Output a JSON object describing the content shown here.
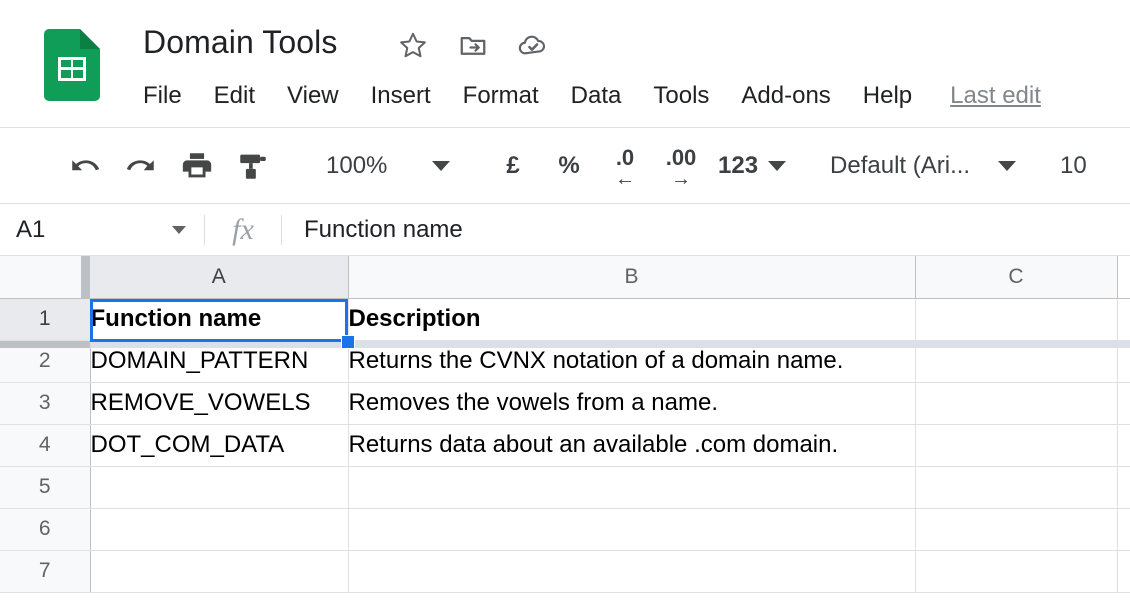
{
  "app": {
    "logo_icon": "google-sheets-logo",
    "doc_title": "Domain Tools"
  },
  "title_icons": [
    {
      "name": "star-icon",
      "label": "Star"
    },
    {
      "name": "move-to-folder-icon",
      "label": "Move to folder"
    },
    {
      "name": "cloud-saved-icon",
      "label": "Saved to Drive"
    }
  ],
  "menubar": {
    "items": [
      {
        "label": "File"
      },
      {
        "label": "Edit"
      },
      {
        "label": "View"
      },
      {
        "label": "Insert"
      },
      {
        "label": "Format"
      },
      {
        "label": "Data"
      },
      {
        "label": "Tools"
      },
      {
        "label": "Add-ons"
      },
      {
        "label": "Help"
      }
    ],
    "last_edit": "Last edit"
  },
  "toolbar": {
    "undo_icon": "undo-icon",
    "redo_icon": "redo-icon",
    "print_icon": "print-icon",
    "paint_format_icon": "paint-format-icon",
    "zoom_value": "100%",
    "currency_label": "£",
    "percent_label": "%",
    "decrease_decimal_digits": ".0",
    "decrease_decimal_arrow": "←",
    "increase_decimal_digits": ".00",
    "increase_decimal_arrow": "→",
    "number_format_label": "123",
    "font_value": "Default (Ari...",
    "font_size_value": "10"
  },
  "formula_bar": {
    "name_box_value": "A1",
    "fx_icon": "fx-icon",
    "formula_value": "Function name"
  },
  "grid": {
    "column_headers": [
      "A",
      "B",
      "C"
    ],
    "selected_column": "A",
    "selected_row": "1",
    "selected_cell": "A1",
    "frozen_rows": 1,
    "rows": [
      {
        "num": "1",
        "a": "Function name",
        "b": "Description",
        "c": ""
      },
      {
        "num": "2",
        "a": "DOMAIN_PATTERN",
        "b": "Returns the CVNX notation of a domain name.",
        "c": ""
      },
      {
        "num": "3",
        "a": "REMOVE_VOWELS",
        "b": "Removes the vowels from a name.",
        "c": ""
      },
      {
        "num": "4",
        "a": "DOT_COM_DATA",
        "b": "Returns data about an available .com domain.",
        "c": ""
      },
      {
        "num": "5",
        "a": "",
        "b": "",
        "c": ""
      },
      {
        "num": "6",
        "a": "",
        "b": "",
        "c": ""
      },
      {
        "num": "7",
        "a": "",
        "b": "",
        "c": ""
      }
    ]
  },
  "colors": {
    "brand_green": "#0f9d58",
    "selection_blue": "#1a73e8",
    "text_primary": "#202124",
    "text_secondary": "#5f6368",
    "header_bg": "#f8f9fa",
    "header_selected_bg": "#e8eaed"
  }
}
